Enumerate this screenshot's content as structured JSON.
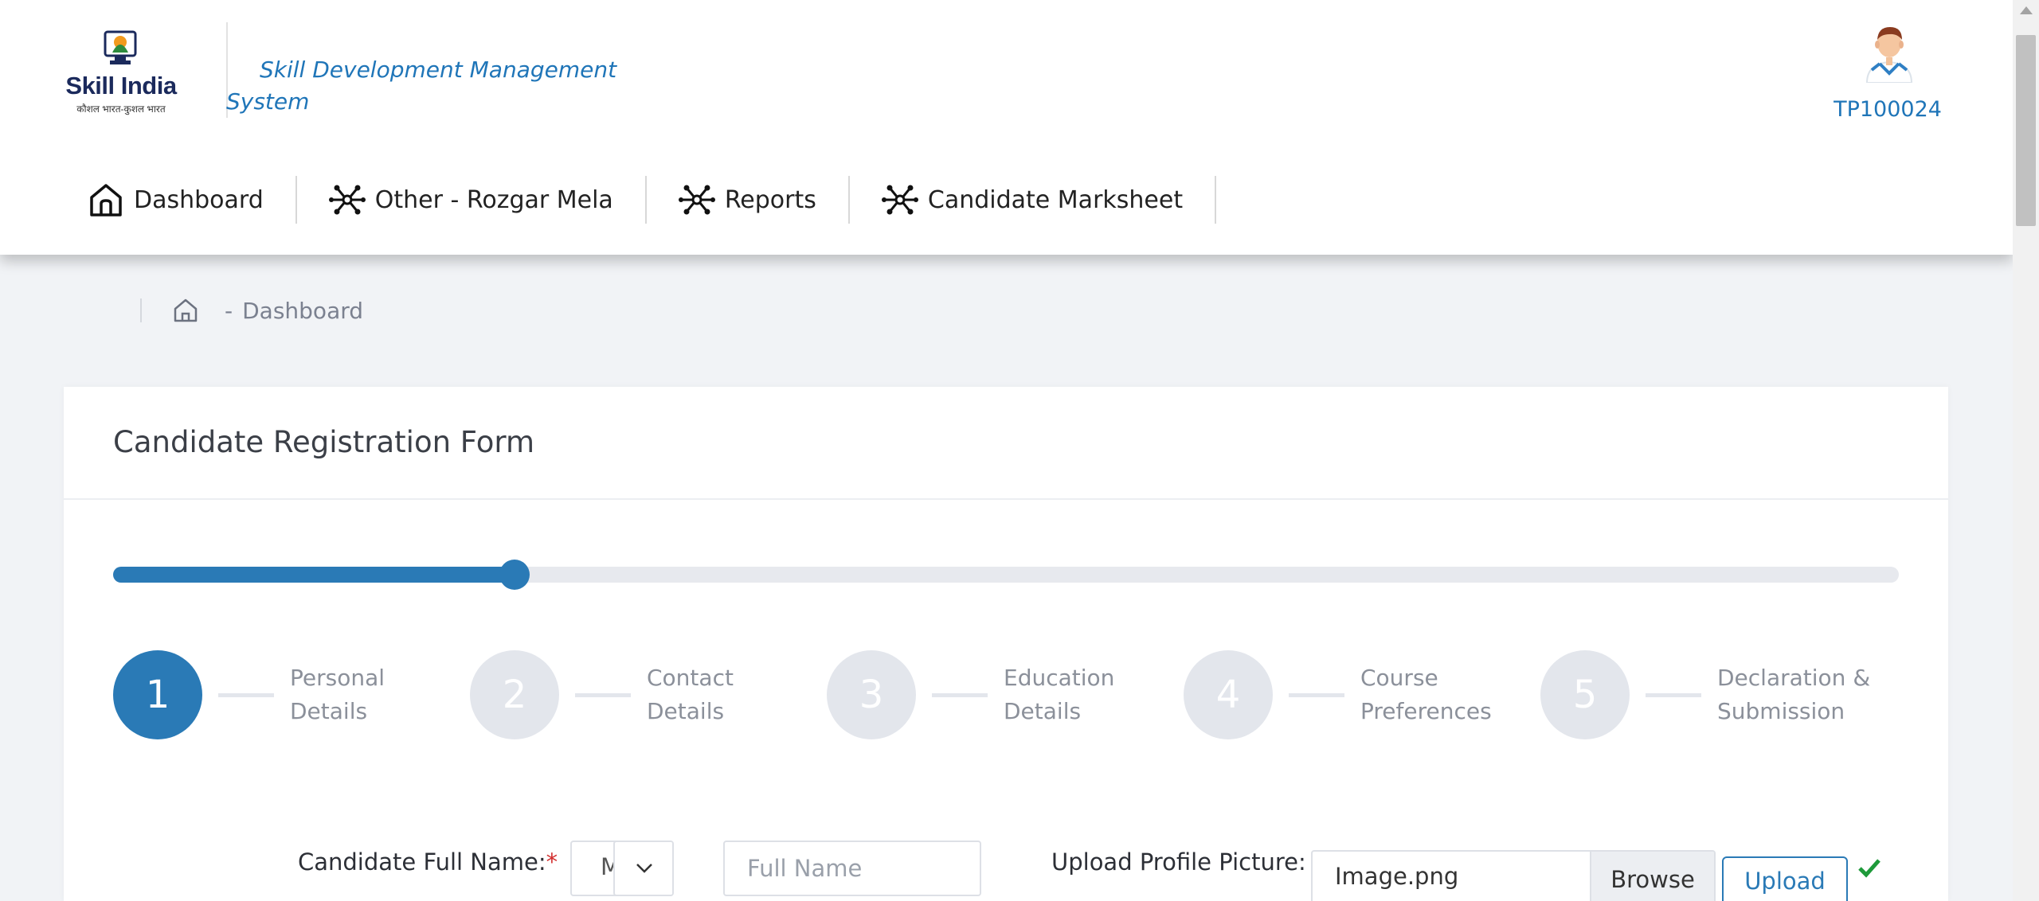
{
  "header": {
    "logo_text": "Skill India",
    "logo_tagline": "कौशल भारत-कुशल भारत",
    "app_title_line1": "Skill Development Management",
    "app_title_line2": "System",
    "user_id": "TP100024"
  },
  "nav": [
    {
      "label": "Dashboard",
      "icon": "home-icon"
    },
    {
      "label": "Other - Rozgar Mela",
      "icon": "network-icon"
    },
    {
      "label": "Reports",
      "icon": "network-icon"
    },
    {
      "label": "Candidate Marksheet",
      "icon": "network-icon"
    }
  ],
  "breadcrumb": {
    "separator": "-",
    "current": "Dashboard"
  },
  "form": {
    "title": "Candidate Registration Form",
    "progress_fraction": 0.225,
    "steps": [
      {
        "num": "1",
        "label": "Personal Details",
        "active": true
      },
      {
        "num": "2",
        "label": "Contact Details",
        "active": false
      },
      {
        "num": "3",
        "label": "Education Details",
        "active": false
      },
      {
        "num": "4",
        "label": "Course Preferences",
        "active": false
      },
      {
        "num": "5",
        "label": "Declaration & Submission",
        "active": false
      }
    ],
    "name_label": "Candidate Full Name:",
    "required_mark": "*",
    "title_select_value": "M",
    "name_placeholder": "Full Name",
    "upload_label": "Upload Profile Picture:",
    "file_name": "Image.png",
    "browse_label": "Browse",
    "upload_button": "Upload"
  },
  "colors": {
    "accent": "#2a7ab6",
    "link": "#1f75b8",
    "success": "#1e9a3a"
  }
}
